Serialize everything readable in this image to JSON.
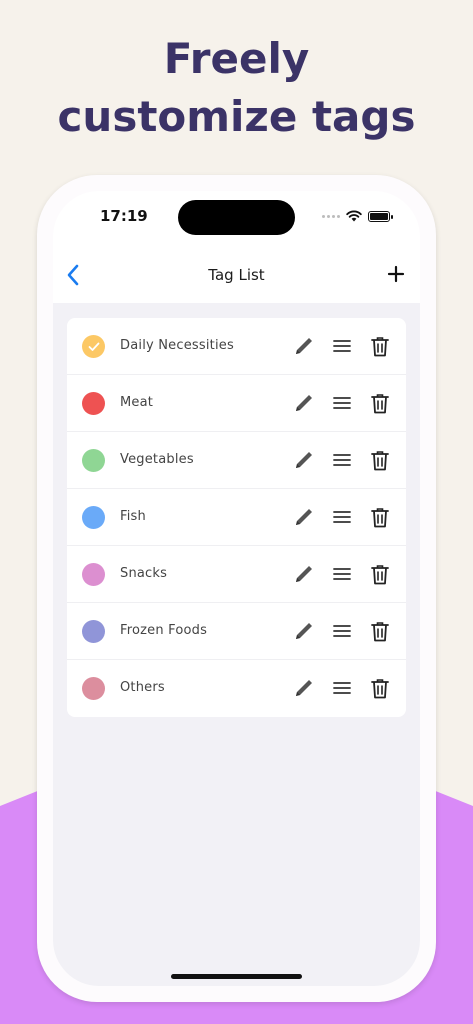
{
  "headline": {
    "line1": "Freely",
    "line2": "customize tags"
  },
  "status_bar": {
    "time": "17:19",
    "icons": [
      "signal-dots-icon",
      "wifi-icon",
      "battery-icon"
    ]
  },
  "navbar": {
    "title": "Tag List",
    "back_icon": "chevron-left-icon",
    "add_icon": "plus-icon",
    "accent_color": "#1a7cf0"
  },
  "tags": [
    {
      "label": "Daily Necessities",
      "color": "#fcc865",
      "selected": true
    },
    {
      "label": "Meat",
      "color": "#ee5252",
      "selected": false
    },
    {
      "label": "Vegetables",
      "color": "#8fd694",
      "selected": false
    },
    {
      "label": "Fish",
      "color": "#6aaaf8",
      "selected": false
    },
    {
      "label": "Snacks",
      "color": "#dc8fd0",
      "selected": false
    },
    {
      "label": "Frozen Foods",
      "color": "#9095d8",
      "selected": false
    },
    {
      "label": "Others",
      "color": "#dc8e9e",
      "selected": false
    }
  ],
  "row_icons": [
    "pencil-icon",
    "drag-handle-icon",
    "trash-icon"
  ],
  "colors": {
    "background": "#f6f2eb",
    "headline": "#3b3367",
    "band": "#d98af7",
    "list_background": "#f2f1f6"
  }
}
